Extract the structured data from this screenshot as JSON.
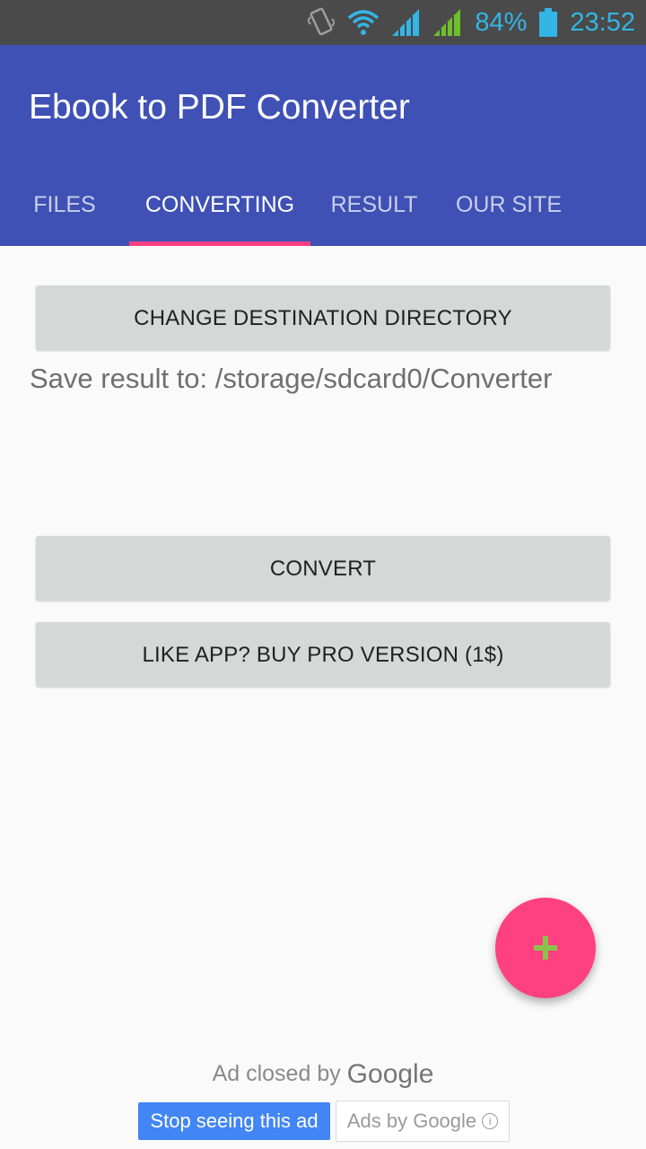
{
  "status_bar": {
    "battery_percent": "84%",
    "time": "23:52",
    "icons": [
      "vibrate-icon",
      "wifi-icon",
      "signal-icon",
      "signal-icon",
      "battery-icon"
    ],
    "accent_color": "#33b5e5"
  },
  "app_bar": {
    "title": "Ebook to PDF Converter",
    "color": "#3f51b5"
  },
  "tabs": [
    {
      "label": "FILES",
      "active": false
    },
    {
      "label": "CONVERTING",
      "active": true
    },
    {
      "label": "RESULT",
      "active": false
    },
    {
      "label": "OUR SITE",
      "active": false
    }
  ],
  "main": {
    "change_dir_label": "CHANGE DESTINATION DIRECTORY",
    "save_result_text": "Save result to: /storage/sdcard0/Converter",
    "convert_label": "CONVERT",
    "buy_pro_label": "LIKE APP? BUY PRO VERSION (1$)"
  },
  "fab": {
    "icon": "plus-icon",
    "color": "#ff4081",
    "icon_color": "#8bc34a"
  },
  "ad": {
    "closed_prefix": "Ad closed by",
    "google_logo": "Google",
    "stop_label": "Stop seeing this ad",
    "ads_by_label": "Ads by Google",
    "stop_color": "#4285f4"
  }
}
